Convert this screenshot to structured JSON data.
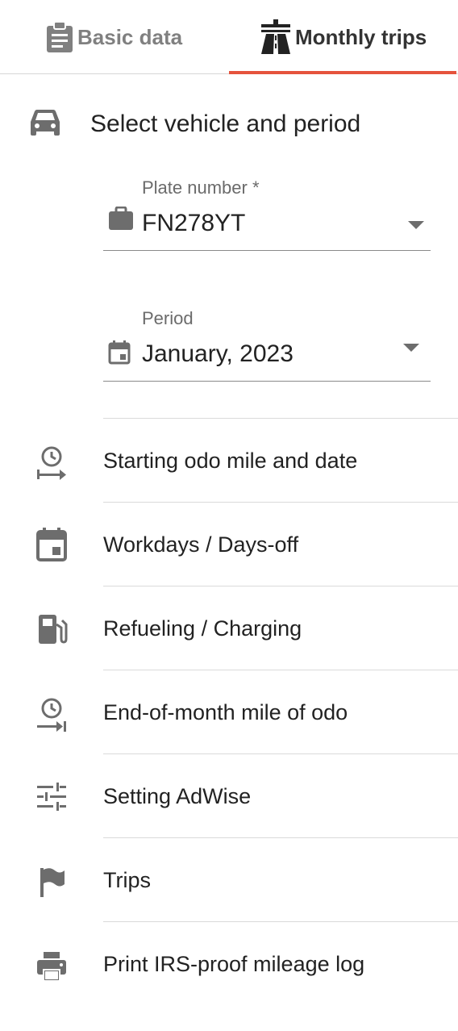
{
  "tabs": [
    {
      "label": "Basic data",
      "icon": "clipboard-icon",
      "active": false
    },
    {
      "label": "Monthly trips",
      "icon": "road-icon",
      "active": true
    }
  ],
  "colors": {
    "accent": "#e5533d",
    "inactive": "#808080",
    "icon": "#6d6d6d"
  },
  "section": {
    "title": "Select vehicle and period",
    "icon": "car-icon"
  },
  "plate": {
    "label": "Plate number *",
    "value": "FN278YT",
    "icon": "briefcase-icon"
  },
  "period": {
    "label": "Period",
    "value": "January, 2023",
    "icon": "calendar-icon"
  },
  "menu": [
    {
      "label": "Starting odo mile and date",
      "icon": "clock-arrow-start-icon"
    },
    {
      "label": "Workdays / Days-off",
      "icon": "calendar-event-icon"
    },
    {
      "label": "Refueling / Charging",
      "icon": "fuel-pump-icon"
    },
    {
      "label": "End-of-month mile of odo",
      "icon": "clock-arrow-end-icon"
    },
    {
      "label": "Setting AdWise",
      "icon": "sliders-icon"
    },
    {
      "label": "Trips",
      "icon": "flag-icon"
    },
    {
      "label": "Print IRS-proof mileage log",
      "icon": "printer-icon"
    }
  ]
}
